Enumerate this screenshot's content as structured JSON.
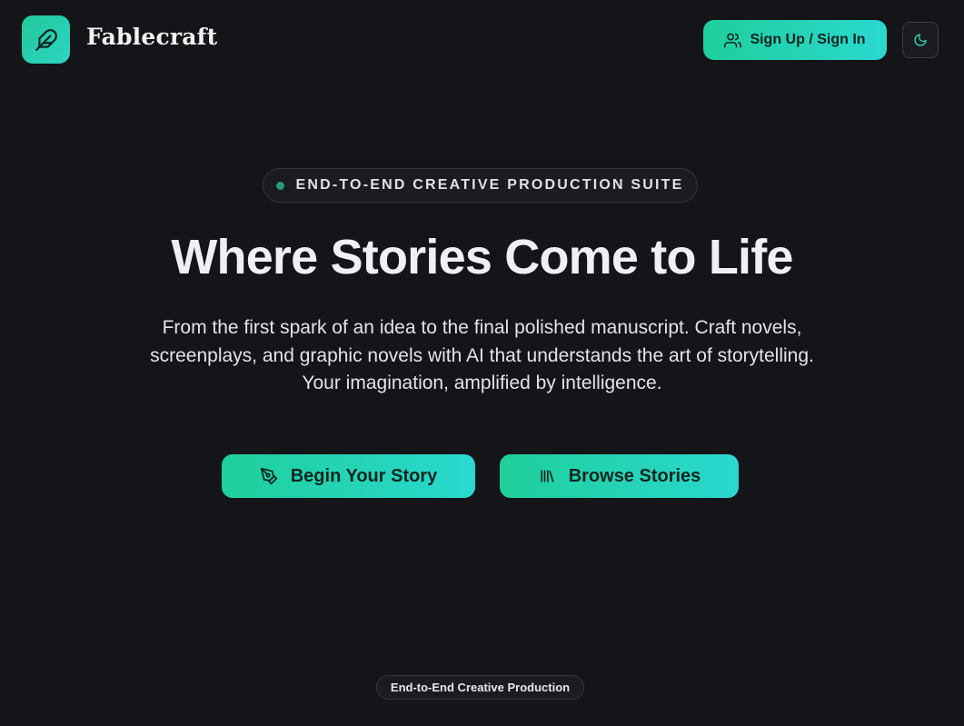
{
  "header": {
    "brand": "Fablecraft",
    "logo_icon": "feather-icon",
    "signin_label": "Sign Up / Sign In",
    "signin_icon": "users-icon",
    "theme_icon": "moon-icon"
  },
  "hero": {
    "badge_text": "END-TO-END CREATIVE PRODUCTION SUITE",
    "title": "Where Stories Come to Life",
    "subtitle_lines": [
      "From the first spark of an idea to the final polished manuscript. Craft novels,",
      "screenplays, and graphic novels with AI that understands the art of storytelling.",
      "Your imagination, amplified by intelligence."
    ],
    "primary_cta": {
      "label": "Begin Your Story",
      "icon": "pen-tool-icon"
    },
    "secondary_cta": {
      "label": "Browse Stories",
      "icon": "library-icon"
    }
  },
  "footer": {
    "pill_text": "End-to-End Creative Production"
  },
  "colors": {
    "background": "#141518",
    "accent_start": "#1fcf9c",
    "accent_end": "#2ad8cf",
    "badge_dot": "#1f9e74"
  }
}
